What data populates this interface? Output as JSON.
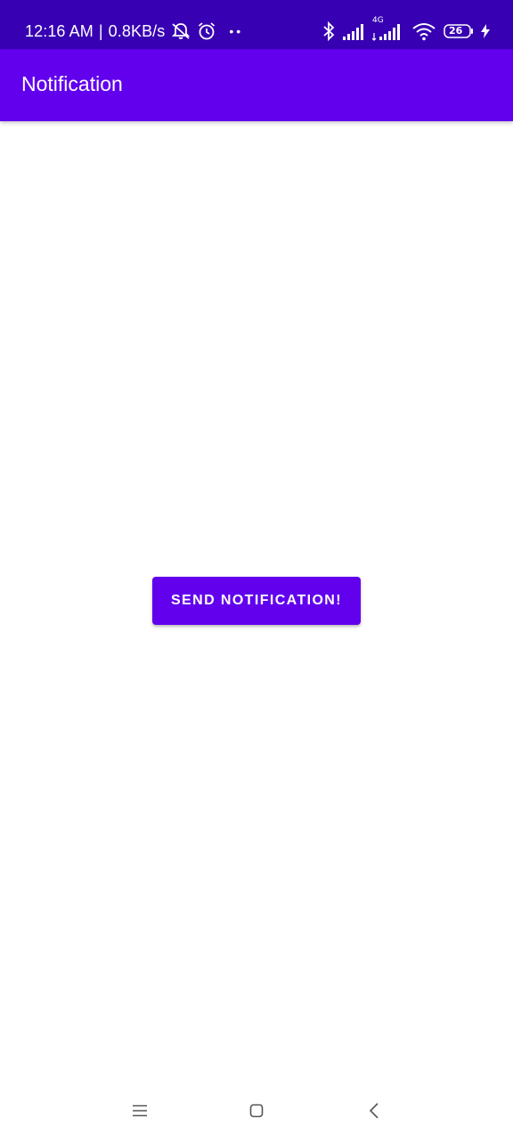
{
  "status_bar": {
    "time": "12:16 AM",
    "separator": "|",
    "net_speed": "0.8KB/s",
    "network_type": "4G",
    "battery_level": "26",
    "icons": [
      "mute-icon",
      "alarm-icon",
      "bluetooth-icon",
      "signal-icon",
      "signal-4g-icon",
      "wifi-icon",
      "battery-icon",
      "charging-icon"
    ],
    "background_color": "#3700b3"
  },
  "app_bar": {
    "title": "Notification",
    "background_color": "#6200ee"
  },
  "main": {
    "send_button_label": "SEND NOTIFICATION!",
    "button_color": "#6200ee"
  },
  "nav_bar": {
    "icons": [
      "menu-icon",
      "home-icon",
      "back-icon"
    ]
  }
}
